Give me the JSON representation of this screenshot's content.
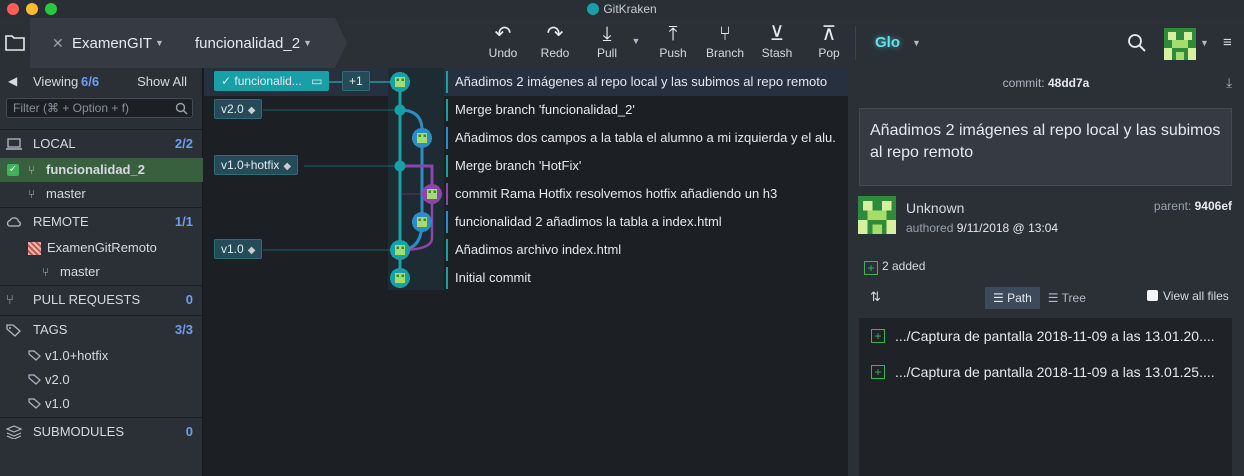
{
  "window": {
    "title": "GitKraken"
  },
  "toolbar": {
    "repo": "ExamenGIT",
    "branch": "funcionalidad_2",
    "actions": [
      {
        "label": "Undo",
        "icon": "undo-icon",
        "glyph": "↶"
      },
      {
        "label": "Redo",
        "icon": "redo-icon",
        "glyph": "↷"
      },
      {
        "label": "Pull",
        "icon": "pull-icon",
        "glyph": "⤓"
      },
      {
        "label": "Push",
        "icon": "push-icon",
        "glyph": "⤒"
      },
      {
        "label": "Branch",
        "icon": "branch-icon",
        "glyph": "⑂"
      },
      {
        "label": "Stash",
        "icon": "stash-icon",
        "glyph": "⊻"
      },
      {
        "label": "Pop",
        "icon": "pop-icon",
        "glyph": "⊼"
      }
    ],
    "glo": "Glo"
  },
  "sidebar": {
    "viewing_label": "Viewing",
    "viewing_count": "6/6",
    "show_all": "Show All",
    "filter_placeholder": "Filter (⌘ + Option + f)",
    "local": {
      "label": "LOCAL",
      "count": "2/2",
      "branches": [
        "funcionalidad_2",
        "master"
      ]
    },
    "remote": {
      "label": "REMOTE",
      "count": "1/1",
      "remote_name": "ExamenGitRemoto",
      "branches": [
        "master"
      ]
    },
    "pull_requests": {
      "label": "PULL REQUESTS",
      "count": "0"
    },
    "tags": {
      "label": "TAGS",
      "count": "3/3",
      "items": [
        "v1.0+hotfix",
        "v2.0",
        "v1.0"
      ]
    },
    "submodules": {
      "label": "SUBMODULES",
      "count": "0"
    }
  },
  "graph": {
    "head_ref": "funcionalid...",
    "head_extra": "+1",
    "refs": [
      "v2.0",
      "v1.0+hotfix",
      "v1.0"
    ],
    "commits": [
      "Añadimos 2 imágenes al repo local y las subimos al repo remoto",
      "Merge branch 'funcionalidad_2'",
      "Añadimos dos campos a la tabla el alumno a mi izquierda y el alu...",
      "Merge branch 'HotFix'",
      "commit Rama Hotfix resolvemos hotfix añadiendo un h3",
      "funcionalidad 2 añadimos la tabla a index.html",
      "Añadimos archivo index.html",
      "Initial commit"
    ]
  },
  "detail": {
    "commit_label": "commit:",
    "sha": "48dd7a",
    "message": "Añadimos 2 imágenes al repo local y las subimos al repo remoto",
    "author": "Unknown",
    "authored_label": "authored",
    "date": "9/11/2018 @ 13:04",
    "parent_label": "parent:",
    "parent_sha": "9406ef",
    "added": "2 added",
    "path_label": "Path",
    "tree_label": "Tree",
    "view_all": "View all files",
    "files": [
      ".../Captura de pantalla 2018-11-09 a las 13.01.20....",
      ".../Captura de pantalla 2018-11-09 a las 13.01.25...."
    ]
  },
  "colors": {
    "accent": "#2b8dc7",
    "graph_teal": "#17a0a8",
    "graph_purple": "#8e44ad",
    "added_green": "#3fb25a"
  }
}
